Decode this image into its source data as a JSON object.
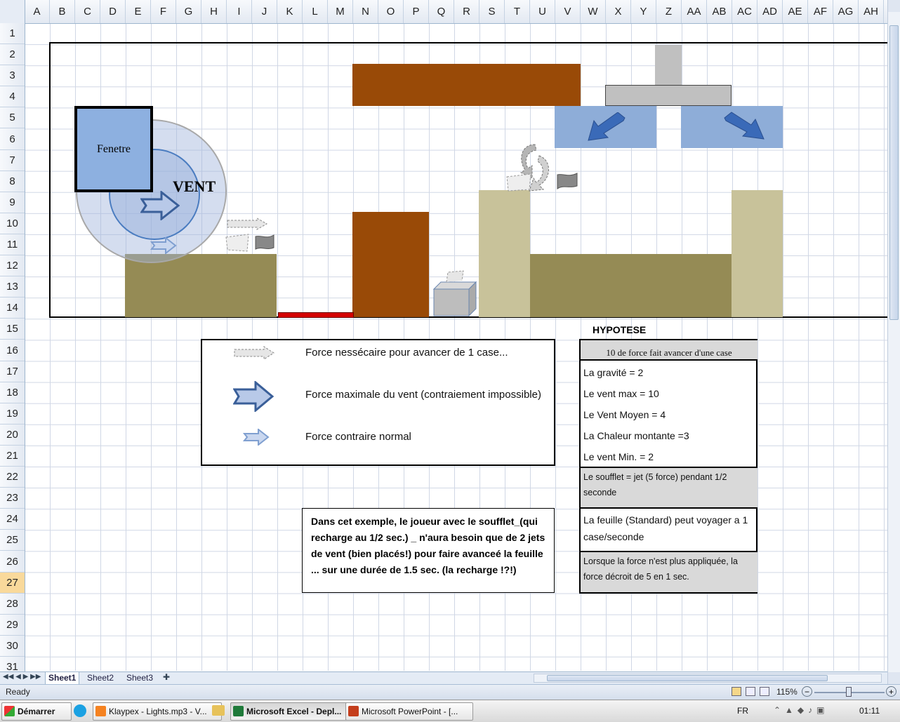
{
  "columns": [
    "A",
    "B",
    "C",
    "D",
    "E",
    "F",
    "G",
    "H",
    "I",
    "J",
    "K",
    "L",
    "M",
    "N",
    "O",
    "P",
    "Q",
    "R",
    "S",
    "T",
    "U",
    "V",
    "W",
    "X",
    "Y",
    "Z",
    "AA",
    "AB",
    "AC",
    "AD",
    "AE",
    "AF",
    "AG",
    "AH"
  ],
  "rows": [
    "1",
    "2",
    "3",
    "4",
    "5",
    "6",
    "7",
    "8",
    "9",
    "10",
    "11",
    "12",
    "13",
    "14",
    "15",
    "16",
    "17",
    "18",
    "19",
    "20",
    "21",
    "22",
    "23",
    "24",
    "25",
    "26",
    "27",
    "28",
    "29",
    "30",
    "31"
  ],
  "selected_row": "27",
  "scene": {
    "window_label": "Fenetre",
    "wind_label": "VENT"
  },
  "legend": {
    "items": [
      {
        "icon": "dashed-gray-arrow-icon",
        "text": "Force nessécaire pour avancer de 1 case..."
      },
      {
        "icon": "large-blue-arrow-icon",
        "text": "Force maximale du vent (contraiement impossible)"
      },
      {
        "icon": "small-light-blue-arrow-icon",
        "text": "Force contraire normal"
      }
    ]
  },
  "hypothesis": {
    "title": "HYPOTESE",
    "header": "10 de force fait avancer d'une case",
    "lines": [
      "La gravité = 2",
      "Le vent max = 10",
      "Le Vent Moyen = 4",
      "La Chaleur montante =3",
      "Le vent Min. = 2"
    ],
    "soufflet": "Le soufflet = jet (5 force) pendant 1/2 seconde",
    "feuille": "La feuille (Standard) peut voyager a 1 case/seconde",
    "decroit": "Lorsque la force n'est plus appliquée, la force décroit de 5 en 1 sec."
  },
  "example_text": "Dans cet exemple, le joueur avec le soufflet_(qui recharge au 1/2 sec.) _ n'aura besoin que de 2 jets de vent (bien placés!) pour faire avanceé la feuille ... sur une durée de 1.5 sec. (la recharge !?!)",
  "sheets": [
    "Sheet1",
    "Sheet2",
    "Sheet3"
  ],
  "active_sheet": "Sheet1",
  "status": {
    "mode": "Ready",
    "zoom": "115%"
  },
  "taskbar": {
    "start_label": "Démarrer",
    "items": [
      "Klaypex - Lights.mp3 - V...",
      "Microsoft Excel - Depl...",
      "Microsoft PowerPoint - [..."
    ],
    "lang": "FR",
    "clock": "01:11"
  },
  "colors": {
    "brown": "#994a07",
    "olive": "#958b55",
    "khaki": "#c8c29a",
    "steel_blue": "#8eadd8",
    "window_blue": "#8db0e0",
    "red": "#d40000"
  }
}
